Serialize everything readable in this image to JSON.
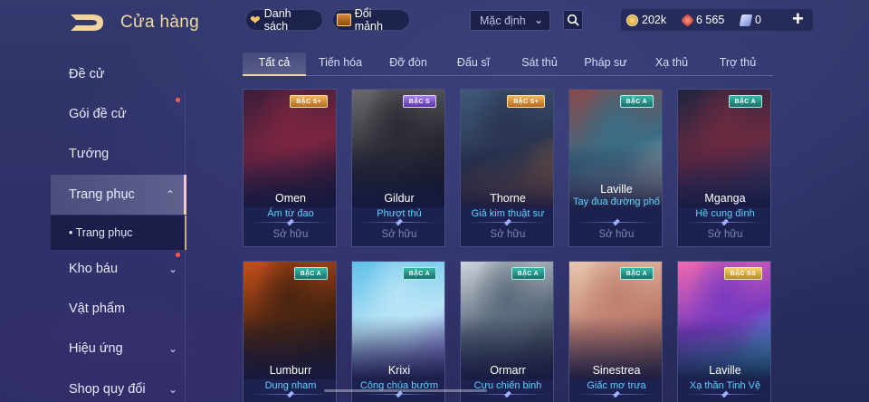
{
  "header": {
    "title": "Cửa hàng",
    "list_label": "Danh sách",
    "exchange_label": "Đổi mảnh",
    "sort_value": "Mặc định",
    "gold": "202k",
    "quan_huy": "6 565",
    "tickets": "0"
  },
  "sidebar": {
    "items": [
      {
        "label": "Đề cử"
      },
      {
        "label": "Gói đề cử"
      },
      {
        "label": "Tướng"
      },
      {
        "label": "Trang phục"
      },
      {
        "label": "• Trang phục"
      },
      {
        "label": "Kho báu"
      },
      {
        "label": "Vật phẩm"
      },
      {
        "label": "Hiệu ứng"
      },
      {
        "label": "Shop quy đổi"
      }
    ]
  },
  "tabs": [
    "Tất cả",
    "Tiến hóa",
    "Đỡ đòn",
    "Đấu sĩ",
    "Sát thủ",
    "Pháp sư",
    "Xạ thủ",
    "Trợ thủ"
  ],
  "cards": [
    {
      "hero": "Omen",
      "skin": "Ám từ đao",
      "badge": "BẬC S+",
      "status": "Sở hữu",
      "art": [
        "#3a1d3a",
        "#7a2540",
        "#14122a"
      ]
    },
    {
      "hero": "Gildur",
      "skin": "Phượt thủ",
      "badge": "BẬC S",
      "status": "Sở hữu",
      "art": [
        "#6a6a70",
        "#2b2b33",
        "#101218"
      ]
    },
    {
      "hero": "Thorne",
      "skin": "Giả kim thuật sư",
      "badge": "BẬC S+",
      "status": "Sở hữu",
      "art": [
        "#3f5a7a",
        "#2a3550",
        "#c47a3a"
      ]
    },
    {
      "hero": "Laville",
      "skin": "Tay đua đường phố",
      "badge": "BẬC A",
      "status": "Sở hữu",
      "art": [
        "#8a4a4a",
        "#3a6c84",
        "#d9cfc4"
      ]
    },
    {
      "hero": "Mganga",
      "skin": "Hề cung đình",
      "badge": "BẬC A",
      "status": "Sở hữu",
      "art": [
        "#1f2440",
        "#6a2a40",
        "#2e3a70"
      ]
    },
    {
      "hero": "Lumburr",
      "skin": "Dung nham",
      "badge": "BẬC A",
      "status": "",
      "art": [
        "#c8501a",
        "#4a2410",
        "#1b120d"
      ]
    },
    {
      "hero": "Krixi",
      "skin": "Công chúa bướm",
      "badge": "BẬC A",
      "status": "",
      "art": [
        "#5ec0ea",
        "#b8e4f6",
        "#7a58c8"
      ]
    },
    {
      "hero": "Ormarr",
      "skin": "Cựu chiến binh",
      "badge": "BẬC A",
      "status": "",
      "art": [
        "#cfd4dc",
        "#5a6a7a",
        "#2a2e38"
      ]
    },
    {
      "hero": "Sinestrea",
      "skin": "Giấc mơ trưa",
      "badge": "BẬC A",
      "status": "",
      "art": [
        "#e8c8b0",
        "#c08070",
        "#8a5a4a"
      ]
    },
    {
      "hero": "Laville",
      "skin": "Xạ thần Tinh Vệ",
      "badge": "BẬC SS",
      "status": "",
      "art": [
        "#f06ab0",
        "#7a3ac0",
        "#3ae0f0"
      ]
    }
  ]
}
